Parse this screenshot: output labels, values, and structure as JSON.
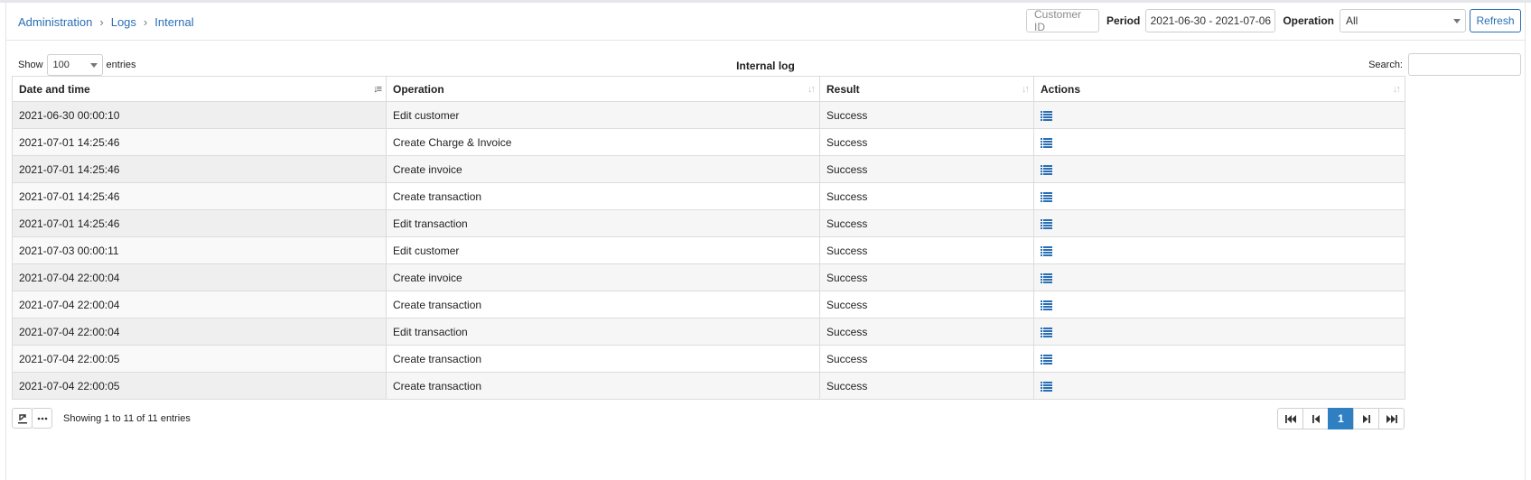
{
  "breadcrumb": {
    "items": [
      "Administration",
      "Logs",
      "Internal"
    ],
    "separator": "›"
  },
  "filters": {
    "customer_id_label": "Customer ID",
    "period_label": "Period",
    "period_value": "2021-06-30 - 2021-07-06",
    "operation_label": "Operation",
    "operation_value": "All",
    "refresh_label": "Refresh"
  },
  "toolbar": {
    "show_label": "Show",
    "entries_value": "100",
    "entries_label": "entries",
    "table_title": "Internal log",
    "search_label": "Search:",
    "search_value": ""
  },
  "table": {
    "columns": [
      "Date and time",
      "Operation",
      "Result",
      "Actions"
    ],
    "sorted_column": "Date and time",
    "rows": [
      {
        "datetime": "2021-06-30 00:00:10",
        "operation": "Edit customer",
        "result": "Success"
      },
      {
        "datetime": "2021-07-01 14:25:46",
        "operation": "Create Charge & Invoice",
        "result": "Success"
      },
      {
        "datetime": "2021-07-01 14:25:46",
        "operation": "Create invoice",
        "result": "Success"
      },
      {
        "datetime": "2021-07-01 14:25:46",
        "operation": "Create transaction",
        "result": "Success"
      },
      {
        "datetime": "2021-07-01 14:25:46",
        "operation": "Edit transaction",
        "result": "Success"
      },
      {
        "datetime": "2021-07-03 00:00:11",
        "operation": "Edit customer",
        "result": "Success"
      },
      {
        "datetime": "2021-07-04 22:00:04",
        "operation": "Create invoice",
        "result": "Success"
      },
      {
        "datetime": "2021-07-04 22:00:04",
        "operation": "Create transaction",
        "result": "Success"
      },
      {
        "datetime": "2021-07-04 22:00:04",
        "operation": "Edit transaction",
        "result": "Success"
      },
      {
        "datetime": "2021-07-04 22:00:05",
        "operation": "Create transaction",
        "result": "Success"
      },
      {
        "datetime": "2021-07-04 22:00:05",
        "operation": "Create transaction",
        "result": "Success"
      }
    ],
    "action_icon": "list-icon"
  },
  "footer": {
    "showing_text": "Showing 1 to 11 of 11 entries",
    "export_icon": "export-icon",
    "more_icon": "more-icon",
    "pagination": {
      "current_page": "1"
    }
  },
  "colors": {
    "accent": "#2a6fb5",
    "active_page": "#2f7fc3"
  }
}
